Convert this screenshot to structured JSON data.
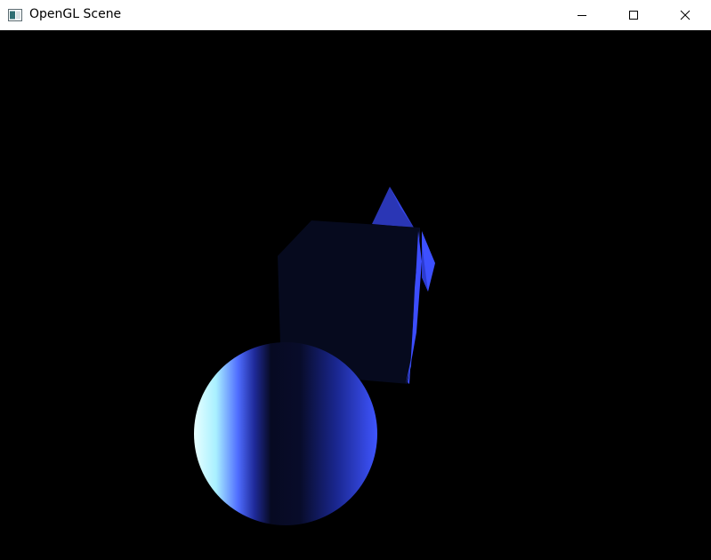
{
  "window": {
    "title": "OpenGL Scene",
    "icon": "window-app-icon",
    "controls": {
      "minimize_icon": "minimize-icon",
      "maximize_icon": "maximize-icon",
      "close_icon": "close-icon"
    }
  },
  "scene": {
    "background_color": "#000000",
    "objects": [
      {
        "name": "sphere",
        "color": "#3b4dff"
      },
      {
        "name": "cube",
        "color": "#3b4dff"
      },
      {
        "name": "pyramid",
        "color": "#3b4dff"
      }
    ]
  }
}
